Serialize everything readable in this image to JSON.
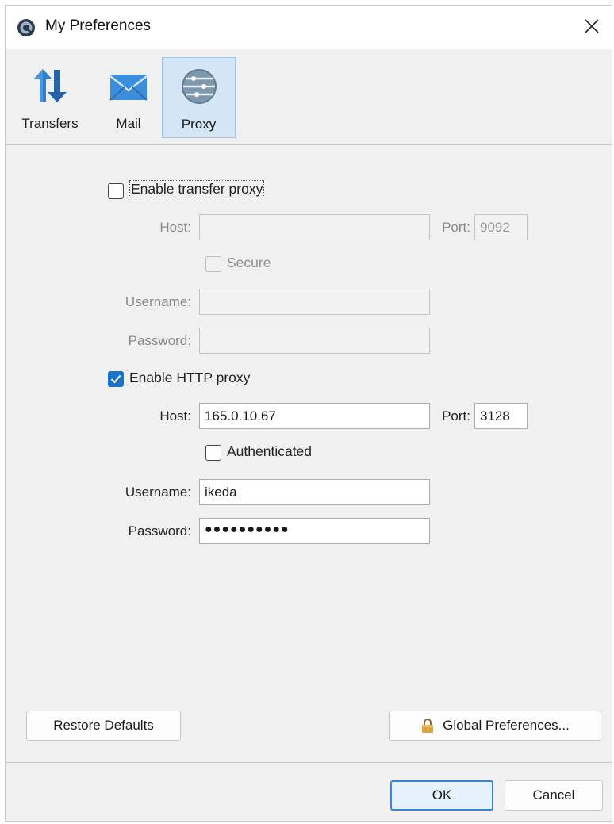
{
  "window": {
    "title": "My Preferences",
    "close_glyph": "✕"
  },
  "toolbar": {
    "items": [
      {
        "label": "Transfers",
        "icon": "transfers-icon",
        "selected": false
      },
      {
        "label": "Mail",
        "icon": "mail-icon",
        "selected": false
      },
      {
        "label": "Proxy",
        "icon": "proxy-icon",
        "selected": true
      }
    ]
  },
  "transfer_proxy": {
    "enable_label": "Enable transfer proxy",
    "enabled": false,
    "host_label": "Host:",
    "host_value": "",
    "port_label": "Port:",
    "port_value": "9092",
    "secure_label": "Secure",
    "secure_checked": false,
    "username_label": "Username:",
    "username_value": "",
    "password_label": "Password:",
    "password_value": ""
  },
  "http_proxy": {
    "enable_label": "Enable HTTP proxy",
    "enabled": true,
    "host_label": "Host:",
    "host_value": "165.0.10.67",
    "port_label": "Port:",
    "port_value": "3128",
    "authenticated_label": "Authenticated",
    "authenticated_checked": false,
    "username_label": "Username:",
    "username_value": "ikeda",
    "password_label": "Password:",
    "password_value": "●●●●●●●●●●"
  },
  "buttons": {
    "restore_defaults": "Restore Defaults",
    "global_preferences": "Global Preferences...",
    "ok": "OK",
    "cancel": "Cancel"
  },
  "colors": {
    "accent": "#1a73c8",
    "selected_tab_bg": "#d4e6f6",
    "window_bg": "#f0f0f0"
  }
}
